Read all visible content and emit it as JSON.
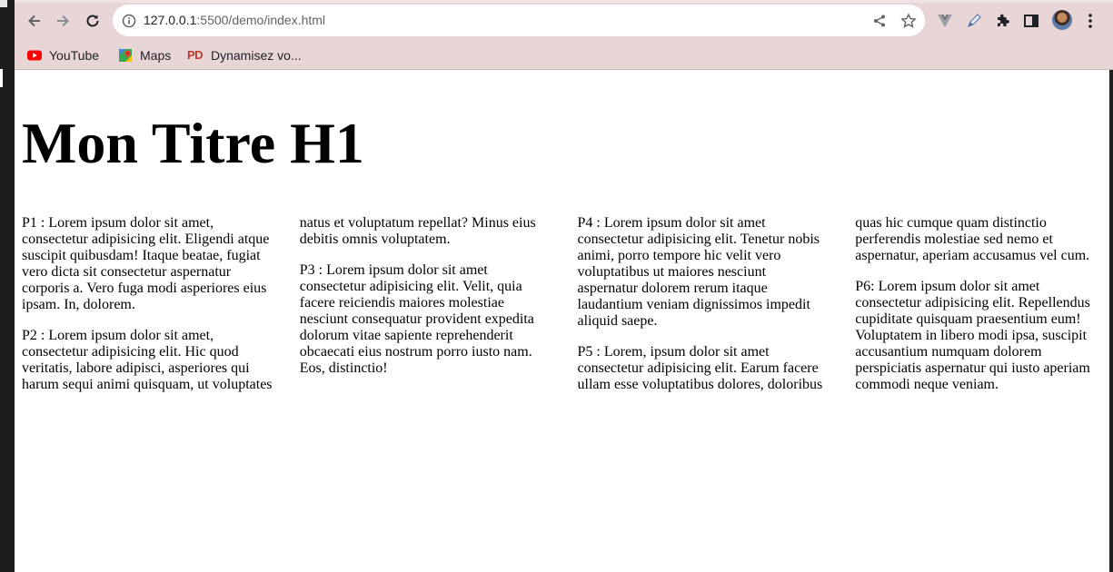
{
  "browser": {
    "url_host": "127.0.0.1",
    "url_rest": ":5500/demo/index.html",
    "bookmarks": [
      {
        "label": "YouTube",
        "icon": "youtube-icon"
      },
      {
        "label": "Maps",
        "icon": "maps-icon"
      },
      {
        "label": "Dynamisez vo...",
        "icon": "pd-icon"
      }
    ],
    "pd_icon_text": "PD"
  },
  "page": {
    "title": "Mon Titre H1",
    "paragraphs": [
      "P1 : Lorem ipsum dolor sit amet, consectetur adipisicing elit. Eligendi atque suscipit quibusdam! Itaque beatae, fugiat vero dicta sit consectetur aspernatur corporis a. Vero fuga modi asperiores eius ipsam. In, dolorem.",
      "P2 : Lorem ipsum dolor sit amet, consectetur adipisicing elit. Hic quod veritatis, labore adipisci, asperiores qui harum sequi animi quisquam, ut voluptates natus et voluptatum repellat? Minus eius debitis omnis voluptatem.",
      "P3 : Lorem ipsum dolor sit amet consectetur adipisicing elit. Velit, quia facere reiciendis maiores molestiae nesciunt consequatur provident expedita dolorum vitae sapiente reprehenderit obcaecati eius nostrum porro iusto nam. Eos, distinctio!",
      "P4 : Lorem ipsum dolor sit amet consectetur adipisicing elit. Tenetur nobis animi, porro tempore hic velit vero voluptatibus ut maiores nesciunt aspernatur dolorem rerum itaque laudantium veniam dignissimos impedit aliquid saepe.",
      "P5 : Lorem, ipsum dolor sit amet consectetur adipisicing elit. Earum facere ullam esse voluptatibus dolores, doloribus quas hic cumque quam distinctio perferendis molestiae sed nemo et aspernatur, aperiam accusamus vel cum.",
      "P6: Lorem ipsum dolor sit amet consectetur adipisicing elit. Repellendus cupiditate quisquam praesentium eum! Voluptatem in libero modi ipsa, suscipit accusantium numquam dolorem perspiciatis aspernatur qui iusto aperiam commodi neque veniam."
    ]
  },
  "colors": {
    "chrome_frame": "#e8d6d7",
    "youtube_red": "#ff0000",
    "pd_red": "#c0392b"
  }
}
